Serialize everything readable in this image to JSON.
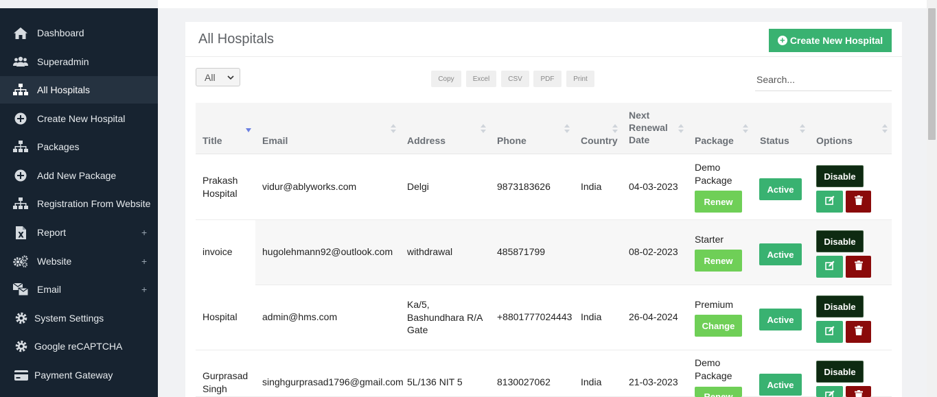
{
  "sidebar": {
    "items": [
      {
        "label": "Dashboard",
        "icon": "home-icon"
      },
      {
        "label": "Superadmin",
        "icon": "users-icon"
      },
      {
        "label": "All Hospitals",
        "icon": "sitemap-icon",
        "active": true
      },
      {
        "label": "Create New Hospital",
        "icon": "plus-circle-icon"
      },
      {
        "label": "Packages",
        "icon": "sitemap-icon"
      },
      {
        "label": "Add New Package",
        "icon": "plus-circle-icon"
      },
      {
        "label": "Registration From Website",
        "icon": "sitemap-icon"
      },
      {
        "label": "Report",
        "icon": "excel-file-icon",
        "expandable": "+"
      },
      {
        "label": "Website",
        "icon": "cogs-icon",
        "expandable": "+"
      },
      {
        "label": "Email",
        "icon": "mail-bulk-icon",
        "expandable": "+"
      },
      {
        "label": "System Settings",
        "icon": "gear-icon"
      },
      {
        "label": "Google reCAPTCHA",
        "icon": "gear-icon"
      },
      {
        "label": "Payment Gateway",
        "icon": "credit-card-icon"
      }
    ]
  },
  "panel": {
    "title": "All Hospitals",
    "create_button": "Create New Hospital"
  },
  "table_controls": {
    "length_selected": "All",
    "export_buttons": [
      "Copy",
      "Excel",
      "CSV",
      "PDF",
      "Print"
    ],
    "search_placeholder": "Search..."
  },
  "table": {
    "columns": [
      "Title",
      "Email",
      "Address",
      "Phone",
      "Country",
      "Next Renewal Date",
      "Package",
      "Status",
      "Options"
    ],
    "column_lines": {
      "next_renewal": [
        "Next",
        "Renewal",
        "Date"
      ]
    },
    "rows": [
      {
        "title": [
          "Prakash",
          "Hospital"
        ],
        "email": "vidur@ablyworks.com",
        "address": [
          "Delgi"
        ],
        "phone": "9873183626",
        "country": "India",
        "renewal": "04-03-2023",
        "package": [
          "Demo",
          "Package"
        ],
        "package_button": "Renew",
        "status": "Active",
        "disable_button": "Disable"
      },
      {
        "title": [
          "invoice"
        ],
        "email": "hugolehmann92@outlook.com",
        "address": [
          "withdrawal"
        ],
        "phone": "485871799",
        "country": "",
        "renewal": "08-02-2023",
        "package": [
          "Starter"
        ],
        "package_button": "Renew",
        "status": "Active",
        "disable_button": "Disable"
      },
      {
        "title": [
          "Hospital"
        ],
        "email": "admin@hms.com",
        "address": [
          "Ka/5,",
          "Bashundhara R/A",
          "Gate"
        ],
        "phone": "+8801777024443",
        "country": "India",
        "renewal": "26-04-2024",
        "package": [
          "Premium"
        ],
        "package_button": "Change",
        "status": "Active",
        "disable_button": "Disable"
      },
      {
        "title": [
          "Gurprasad",
          "Singh"
        ],
        "email": "singhgurprasad1796@gmail.com",
        "address": [
          "5L/136 NIT 5"
        ],
        "phone": "8130027062",
        "country": "India",
        "renewal": "21-03-2023",
        "package": [
          "Demo",
          "Package"
        ],
        "package_button": "Renew",
        "status": "Active",
        "disable_button": "Disable"
      }
    ]
  },
  "colors": {
    "sidebar_bg": "#172330",
    "primary_green": "#39b271",
    "light_green": "#6fcf57",
    "disable_dark": "#0e2a12",
    "delete_red": "#8a0a0a"
  }
}
